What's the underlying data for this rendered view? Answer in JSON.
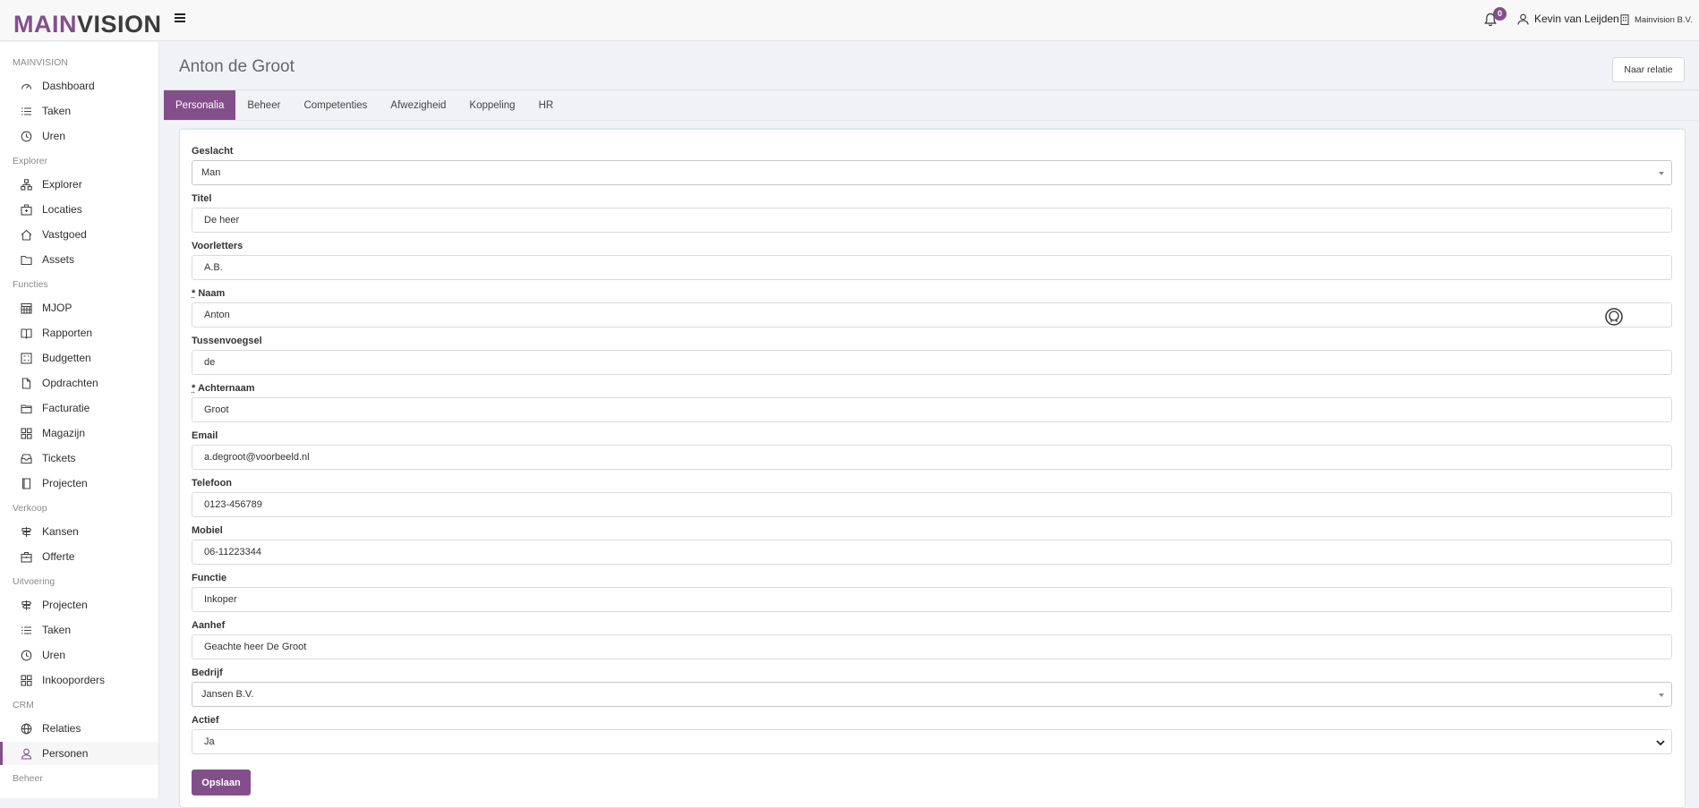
{
  "topbar": {
    "logo_part1": "MAIN",
    "logo_part2": "VISION",
    "notification_count": "0",
    "user_name": "Kevin van Leijden",
    "company": "Mainvision B.V."
  },
  "sidebar": {
    "sections": [
      {
        "title": "MAINVISION",
        "items": [
          {
            "label": "Dashboard",
            "icon": "dashboard-icon"
          },
          {
            "label": "Taken",
            "icon": "list-icon"
          },
          {
            "label": "Uren",
            "icon": "clock-icon"
          }
        ]
      },
      {
        "title": "Explorer",
        "items": [
          {
            "label": "Explorer",
            "icon": "hierarchy-icon"
          },
          {
            "label": "Locaties",
            "icon": "building-icon"
          },
          {
            "label": "Vastgoed",
            "icon": "home-icon"
          },
          {
            "label": "Assets",
            "icon": "folder-icon"
          }
        ]
      },
      {
        "title": "Functies",
        "items": [
          {
            "label": "MJOP",
            "icon": "calendar-icon"
          },
          {
            "label": "Rapporten",
            "icon": "book-icon"
          },
          {
            "label": "Budgetten",
            "icon": "budget-icon"
          },
          {
            "label": "Opdrachten",
            "icon": "file-icon"
          },
          {
            "label": "Facturatie",
            "icon": "invoice-folder-icon"
          },
          {
            "label": "Magazijn",
            "icon": "grid-icon"
          },
          {
            "label": "Tickets",
            "icon": "inbox-icon"
          },
          {
            "label": "Projecten",
            "icon": "book-closed-icon"
          }
        ]
      },
      {
        "title": "Verkoop",
        "items": [
          {
            "label": "Kansen",
            "icon": "signpost-icon"
          },
          {
            "label": "Offerte",
            "icon": "briefcase-icon"
          }
        ]
      },
      {
        "title": "Uitvoering",
        "items": [
          {
            "label": "Projecten",
            "icon": "signpost-icon"
          },
          {
            "label": "Taken",
            "icon": "list-icon"
          },
          {
            "label": "Uren",
            "icon": "clock-icon"
          },
          {
            "label": "Inkooporders",
            "icon": "grid-icon"
          }
        ]
      },
      {
        "title": "CRM",
        "items": [
          {
            "label": "Relaties",
            "icon": "globe-icon"
          },
          {
            "label": "Personen",
            "icon": "person-icon",
            "active": true
          }
        ]
      },
      {
        "title": "Beheer",
        "items": []
      }
    ]
  },
  "header": {
    "title": "Anton de Groot",
    "button_label": "Naar relatie"
  },
  "tabs": [
    "Personalia",
    "Beheer",
    "Competenties",
    "Afwezigheid",
    "Koppeling",
    "HR"
  ],
  "active_tab": "Personalia",
  "form": {
    "fields": [
      {
        "label": "Geslacht",
        "value": "Man",
        "type": "select"
      },
      {
        "label": "Titel",
        "value": "De heer",
        "type": "text"
      },
      {
        "label": "Voorletters",
        "value": "A.B.",
        "type": "text"
      },
      {
        "label": "Naam",
        "value": "Anton",
        "type": "text",
        "required": true
      },
      {
        "label": "Tussenvoegsel",
        "value": "de",
        "type": "text"
      },
      {
        "label": "Achternaam",
        "value": "Groot",
        "type": "text",
        "required": true
      },
      {
        "label": "Email",
        "value": "a.degroot@voorbeeld.nl",
        "type": "text"
      },
      {
        "label": "Telefoon",
        "value": "0123-456789",
        "type": "text"
      },
      {
        "label": "Mobiel",
        "value": "06-11223344",
        "type": "text"
      },
      {
        "label": "Functie",
        "value": "Inkoper",
        "type": "text"
      },
      {
        "label": "Aanhef",
        "value": "Geachte heer De Groot",
        "type": "text"
      },
      {
        "label": "Bedrijf",
        "value": "Jansen B.V.",
        "type": "select"
      },
      {
        "label": "Actief",
        "value": "Ja",
        "type": "native-select"
      }
    ],
    "required_marker": "*",
    "save_label": "Opslaan"
  },
  "colors": {
    "accent": "#834f8a"
  }
}
